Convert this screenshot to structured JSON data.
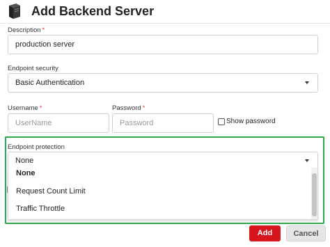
{
  "header": {
    "title": "Add Backend Server",
    "icon": "server-icon"
  },
  "form": {
    "description": {
      "label": "Description",
      "required_mark": "*",
      "value": "production server"
    },
    "endpoint_security": {
      "label": "Endpoint security",
      "value": "Basic Authentication"
    },
    "username": {
      "label": "Username",
      "required_mark": "*",
      "placeholder": "UserName"
    },
    "password": {
      "label": "Password",
      "required_mark": "*",
      "placeholder": "Password"
    },
    "show_password": {
      "label": "Show password",
      "checked": false
    },
    "endpoint_protection": {
      "label": "Endpoint protection",
      "value": "None",
      "options": [
        "None",
        "Request Count Limit",
        "Traffic Throttle"
      ]
    }
  },
  "actions": {
    "add_label": "Add",
    "cancel_label": "Cancel"
  },
  "colors": {
    "accent": "#d7151c",
    "highlight": "#2ea84a"
  }
}
